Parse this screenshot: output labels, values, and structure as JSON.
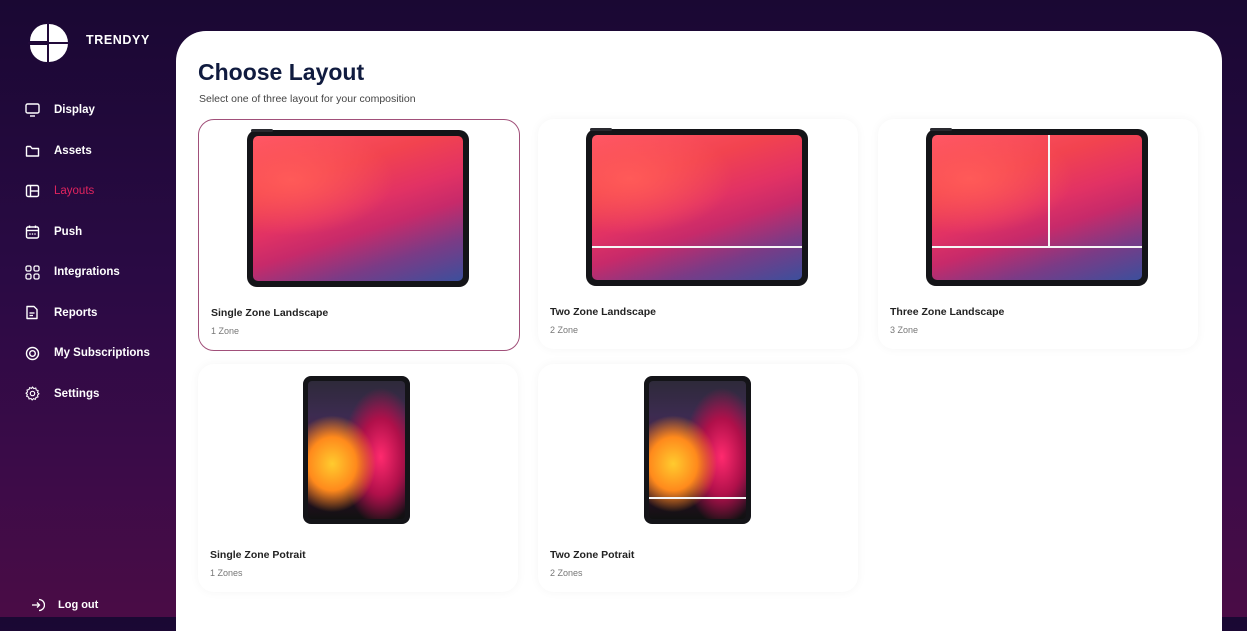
{
  "brand": {
    "name": "TRENDYY"
  },
  "sidebar": {
    "items": [
      {
        "label": "Display",
        "icon": "monitor-icon"
      },
      {
        "label": "Assets",
        "icon": "folder-icon"
      },
      {
        "label": "Layouts",
        "icon": "layout-icon",
        "active": true
      },
      {
        "label": "Push",
        "icon": "calendar-icon"
      },
      {
        "label": "Integrations",
        "icon": "grid-icon"
      },
      {
        "label": "Reports",
        "icon": "document-icon"
      },
      {
        "label": "My Subscriptions",
        "icon": "subscription-icon"
      },
      {
        "label": "Settings",
        "icon": "gear-icon"
      }
    ],
    "logout": {
      "label": "Log out",
      "icon": "logout-icon"
    }
  },
  "main": {
    "title": "Choose Layout",
    "subtitle": "Select one of three layout for your composition",
    "layouts": [
      {
        "name": "Single Zone Landscape",
        "zones": "1 Zone",
        "selected": true
      },
      {
        "name": "Two Zone Landscape",
        "zones": "2 Zone"
      },
      {
        "name": "Three Zone Landscape",
        "zones": "3 Zone"
      },
      {
        "name": "Single Zone Potrait",
        "zones": "1 Zones"
      },
      {
        "name": "Two Zone Potrait",
        "zones": "2 Zones"
      }
    ]
  },
  "colors": {
    "accent": "#e0245e",
    "selected_border": "#a1507a",
    "title": "#101b3f"
  }
}
